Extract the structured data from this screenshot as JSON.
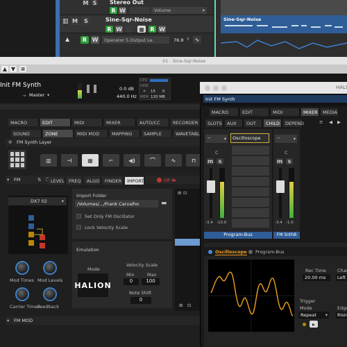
{
  "tracks": [
    {
      "name": "Stereo Out",
      "insert": "Volume"
    },
    {
      "name": "Sine-Sqr-Noise",
      "btn_w": "W",
      "btn_r": "R",
      "btn_w2": "W"
    },
    {
      "name": "",
      "param": "Operator 5.Output Le.",
      "value": "76.9"
    }
  ],
  "clip": {
    "name": "Sine-Sqr-Noise"
  },
  "track_buttons": {
    "m": "M",
    "s": "S",
    "r": "R",
    "w": "W"
  },
  "window_title": "01 - Sine-Sqr-Noise",
  "program": {
    "name": "Init FM Synth",
    "master_label": "Master",
    "volume": "0.0 dB",
    "tune": "440.0 Hz",
    "cpu_label": "CPU",
    "disk_label": "DISK",
    "voices_label": "#",
    "voices": "15",
    "mem_label": "MEM",
    "mem": "120 MB",
    "extra_label": "0"
  },
  "main_tabs": [
    "MACRO",
    "EDIT",
    "MIDI",
    "MIXER",
    "AUTO/CC",
    "RECORDER"
  ],
  "sub_tabs": [
    "SOUND",
    "ZONE",
    "MIDI MOD",
    "MAPPING",
    "SAMPLE",
    "WAVETABLE"
  ],
  "layer": {
    "title": "FM Synth Layer"
  },
  "fm": {
    "title": "FM",
    "tabs": [
      "LEVEL",
      "FREQ",
      "ALGO",
      "FINDER",
      "IMPORT"
    ],
    "op_label": "OP 6",
    "preset": "DX7 02",
    "knobs": [
      "Mod Times",
      "Mod Levels",
      "Carrier Times",
      "Feedback"
    ],
    "footer": "FM MOD"
  },
  "import": {
    "folder_label": "Import Folder",
    "folder_path": "/Volumes/.../Frank Carvalho",
    "opt1": "Set Only FM Oscillator",
    "opt2": "Lock Velocity Scale"
  },
  "emulation": {
    "title": "Emulation",
    "mode_label": "Mode",
    "logo": "HALION",
    "vel_label": "Velocity Scale",
    "min_label": "Min",
    "max_label": "Max",
    "min": "0",
    "max": "100",
    "shift_label": "Note Shift",
    "shift": "0"
  },
  "halion": {
    "title": "HALI",
    "program": "Init FM Synth",
    "tabs": [
      "MACRO",
      "EDIT",
      "MIDI",
      "MIXER",
      "MEDIA"
    ],
    "sub_tabs": [
      "SLOTS",
      "AUX",
      "OUT",
      "CHILD",
      "DEPEND"
    ],
    "insert": "Oscilloscope",
    "c_label": "C",
    "ch1": {
      "m": "m",
      "s": "s",
      "val_a": "-3.4",
      "val_b": "-10.0",
      "name": "Program-Bus"
    },
    "ch2": {
      "m": "m",
      "s": "s",
      "val_a": "-3.4",
      "val_b": "-1.0",
      "name": "FM SnthB"
    }
  },
  "scope": {
    "tab": "Oscilloscope",
    "bus": "Program-Bus",
    "rec_label": "Rec Time",
    "rec_value": "20.00 ms",
    "chan_label": "Chan",
    "chan_value": "Left",
    "trigger_label": "Trigger",
    "mode_label": "Mode",
    "mode_value": "Repeat",
    "edge_label": "Edge",
    "edge_value": "Risin"
  }
}
